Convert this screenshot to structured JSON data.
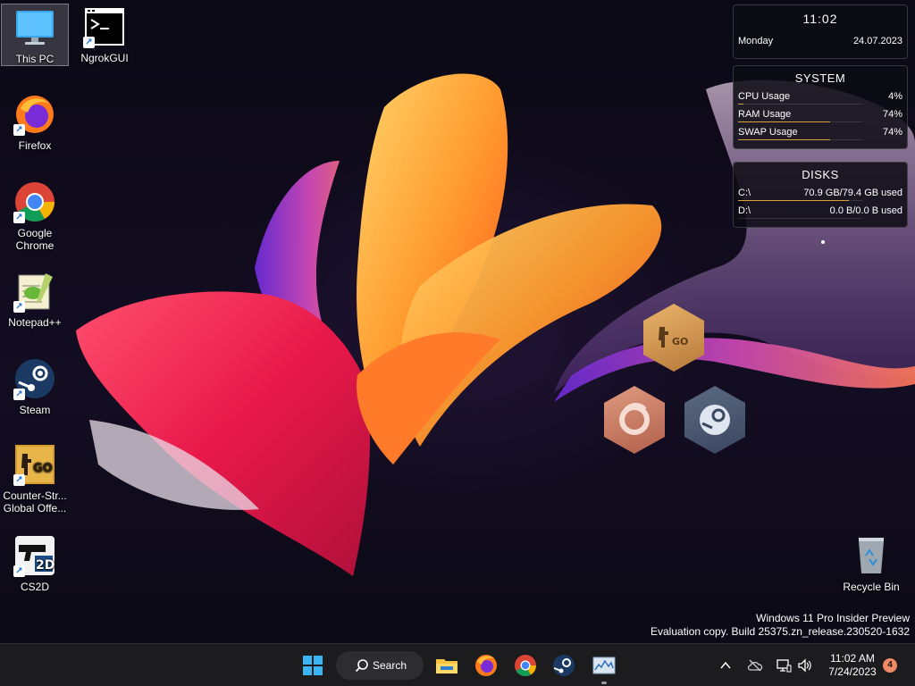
{
  "desktop": {
    "icons": [
      {
        "label": "This PC",
        "icon": "computer-icon"
      },
      {
        "label": "NgrokGUI",
        "icon": "terminal-icon"
      },
      {
        "label": "Firefox",
        "icon": "firefox-icon"
      },
      {
        "label": "Google Chrome",
        "icon": "chrome-icon"
      },
      {
        "label": "Notepad++",
        "icon": "notepadpp-icon"
      },
      {
        "label": "Steam",
        "icon": "steam-icon"
      },
      {
        "label": "Counter-Str... Global Offe...",
        "icon": "csgo-icon"
      },
      {
        "label": "CS2D",
        "icon": "cs2d-icon"
      },
      {
        "label": "Recycle Bin",
        "icon": "recycle-bin-icon"
      }
    ]
  },
  "widgets": {
    "clock": {
      "time": "11:02",
      "day": "Monday",
      "date": "24.07.2023"
    },
    "system": {
      "title": "SYSTEM",
      "rows": [
        {
          "label": "CPU Usage",
          "value": "4%",
          "fraction": 0.04
        },
        {
          "label": "RAM Usage",
          "value": "74%",
          "fraction": 0.74
        },
        {
          "label": "SWAP Usage",
          "value": "74%",
          "fraction": 0.74
        }
      ]
    },
    "disks": {
      "title": "DISKS",
      "rows": [
        {
          "label": "C:\\",
          "value": "70.9 GB/79.4 GB used",
          "fraction": 0.89
        },
        {
          "label": "D:\\",
          "value": "0.0 B/0.0 B used",
          "fraction": 0.0
        }
      ]
    }
  },
  "watermark": {
    "line1": "Windows 11 Pro Insider Preview",
    "line2": "Evaluation copy. Build 25375.zn_release.230520-1632"
  },
  "taskbar": {
    "search_label": "Search",
    "clock_time": "11:02 AM",
    "clock_date": "7/24/2023",
    "notification_count": "4"
  },
  "colors": {
    "accent": "#d6a33a",
    "taskbar": "#1c1c1f",
    "badge": "#f08a64"
  }
}
